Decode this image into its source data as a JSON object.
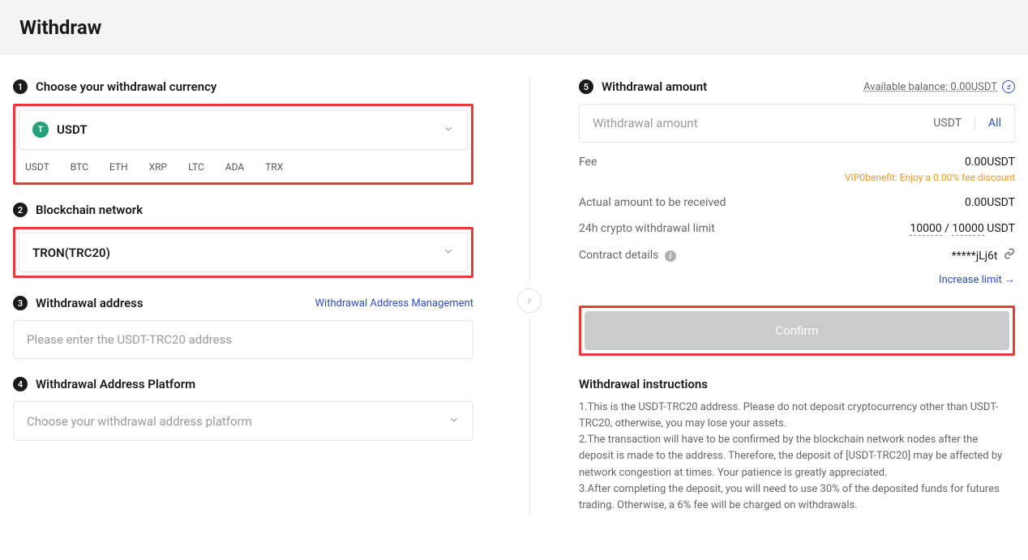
{
  "page": {
    "title": "Withdraw"
  },
  "step1": {
    "number": "1",
    "title": "Choose your withdrawal currency",
    "selected": "USDT",
    "coin_symbol": "T",
    "chips": [
      "USDT",
      "BTC",
      "ETH",
      "XRP",
      "LTC",
      "ADA",
      "TRX"
    ]
  },
  "step2": {
    "number": "2",
    "title": "Blockchain network",
    "selected": "TRON(TRC20)"
  },
  "step3": {
    "number": "3",
    "title": "Withdrawal address",
    "management_link": "Withdrawal Address Management",
    "placeholder": "Please enter the USDT-TRC20 address"
  },
  "step4": {
    "number": "4",
    "title": "Withdrawal Address Platform",
    "placeholder": "Choose your withdrawal address platform"
  },
  "step5": {
    "number": "5",
    "title": "Withdrawal amount",
    "balance_label": "Available balance: 0.00USDT",
    "placeholder": "Withdrawal amount",
    "unit": "USDT",
    "all": "All",
    "fee_label": "Fee",
    "fee_value": "0.00USDT",
    "vip_text": "VIP0benefit: Enjoy a 0.00% fee discount",
    "actual_label": "Actual amount to be received",
    "actual_value": "0.00USDT",
    "limit_label": "24h crypto withdrawal limit",
    "limit_used": "10000",
    "limit_total": "10000",
    "limit_unit": "USDT",
    "contract_label": "Contract details",
    "contract_value": "*****jLj6t",
    "increase_link": "Increase limit →",
    "confirm": "Confirm"
  },
  "instructions": {
    "title": "Withdrawal instructions",
    "p1": "1.This is the USDT-TRC20 address. Please do not deposit cryptocurrency other than USDT-TRC20, otherwise, you may lose your assets.",
    "p2": "2.The transaction will have to be confirmed by the blockchain network nodes after the deposit is made to the address. Therefore, the deposit of [USDT-TRC20] may be affected by network congestion at times. Your patience is greatly appreciated.",
    "p3": "3.After completing the deposit, you will need to use 30% of the deposited funds for futures trading. Otherwise, a 6% fee will be charged on withdrawals."
  }
}
